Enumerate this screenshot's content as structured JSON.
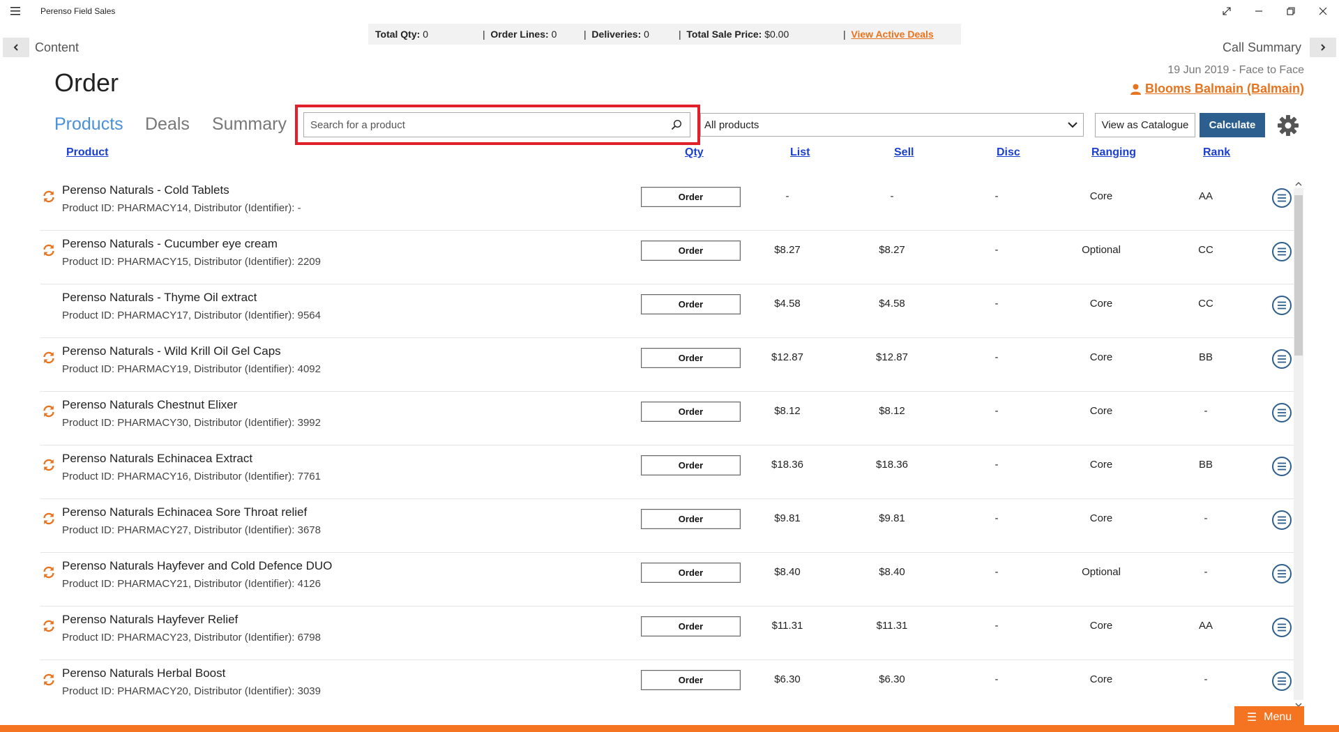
{
  "app": {
    "title": "Perenso Field Sales"
  },
  "totals": {
    "qty_label": "Total Qty:",
    "qty": "0",
    "lines_label": "Order Lines:",
    "lines": "0",
    "deliveries_label": "Deliveries:",
    "deliveries": "0",
    "price_label": "Total Sale Price:",
    "price": "$0.00",
    "deals_link": "View Active Deals"
  },
  "nav": {
    "back_label": "Content",
    "forward_label": "Call Summary"
  },
  "call": {
    "meta": "19 Jun 2019  -  Face to Face",
    "customer": "Blooms Balmain (Balmain)"
  },
  "page": {
    "title": "Order"
  },
  "tabs": [
    {
      "label": "Products",
      "active": true
    },
    {
      "label": "Deals",
      "active": false
    },
    {
      "label": "Summary",
      "active": false
    }
  ],
  "search": {
    "placeholder": "Search for a product",
    "value": ""
  },
  "filter": {
    "selected": "All products"
  },
  "toolbar": {
    "catalogue_label": "View as Catalogue",
    "calculate_label": "Calculate"
  },
  "columns": {
    "product": "Product",
    "qty": "Qty",
    "list": "List",
    "sell": "Sell",
    "disc": "Disc",
    "ranging": "Ranging",
    "rank": "Rank"
  },
  "order_label": "Order",
  "menu_label": "Menu",
  "colors": {
    "accent": "#f47421",
    "link": "#1a3fcf",
    "tab_active": "#4a90d9",
    "calculate": "#2c5e8e",
    "highlight": "#e0202b"
  },
  "products": [
    {
      "name": "Perenso Naturals - Cold Tablets",
      "meta": "Product ID: PHARMACY14, Distributor (Identifier): -",
      "list": "-",
      "sell": "-",
      "disc": "-",
      "ranging": "Core",
      "rank": "AA",
      "sync": true
    },
    {
      "name": "Perenso Naturals - Cucumber eye cream",
      "meta": "Product ID: PHARMACY15, Distributor (Identifier): 2209",
      "list": "$8.27",
      "sell": "$8.27",
      "disc": "-",
      "ranging": "Optional",
      "rank": "CC",
      "sync": true
    },
    {
      "name": "Perenso Naturals - Thyme Oil extract",
      "meta": "Product ID: PHARMACY17, Distributor (Identifier): 9564",
      "list": "$4.58",
      "sell": "$4.58",
      "disc": "-",
      "ranging": "Core",
      "rank": "CC",
      "sync": false
    },
    {
      "name": "Perenso Naturals - Wild Krill Oil Gel Caps",
      "meta": "Product ID: PHARMACY19, Distributor (Identifier): 4092",
      "list": "$12.87",
      "sell": "$12.87",
      "disc": "-",
      "ranging": "Core",
      "rank": "BB",
      "sync": true
    },
    {
      "name": "Perenso Naturals Chestnut Elixer",
      "meta": "Product ID: PHARMACY30, Distributor (Identifier): 3992",
      "list": "$8.12",
      "sell": "$8.12",
      "disc": "-",
      "ranging": "Core",
      "rank": "-",
      "sync": true
    },
    {
      "name": "Perenso Naturals Echinacea Extract",
      "meta": "Product ID: PHARMACY16, Distributor (Identifier): 7761",
      "list": "$18.36",
      "sell": "$18.36",
      "disc": "-",
      "ranging": "Core",
      "rank": "BB",
      "sync": true
    },
    {
      "name": "Perenso Naturals Echinacea Sore Throat relief",
      "meta": "Product ID: PHARMACY27, Distributor (Identifier): 3678",
      "list": "$9.81",
      "sell": "$9.81",
      "disc": "-",
      "ranging": "Core",
      "rank": "-",
      "sync": true
    },
    {
      "name": "Perenso Naturals Hayfever and Cold Defence DUO",
      "meta": "Product ID: PHARMACY21, Distributor (Identifier): 4126",
      "list": "$8.40",
      "sell": "$8.40",
      "disc": "-",
      "ranging": "Optional",
      "rank": "-",
      "sync": true
    },
    {
      "name": "Perenso Naturals Hayfever Relief",
      "meta": "Product ID: PHARMACY23, Distributor (Identifier): 6798",
      "list": "$11.31",
      "sell": "$11.31",
      "disc": "-",
      "ranging": "Core",
      "rank": "AA",
      "sync": true
    },
    {
      "name": "Perenso Naturals Herbal Boost",
      "meta": "Product ID: PHARMACY20, Distributor (Identifier): 3039",
      "list": "$6.30",
      "sell": "$6.30",
      "disc": "-",
      "ranging": "Core",
      "rank": "-",
      "sync": true
    }
  ]
}
